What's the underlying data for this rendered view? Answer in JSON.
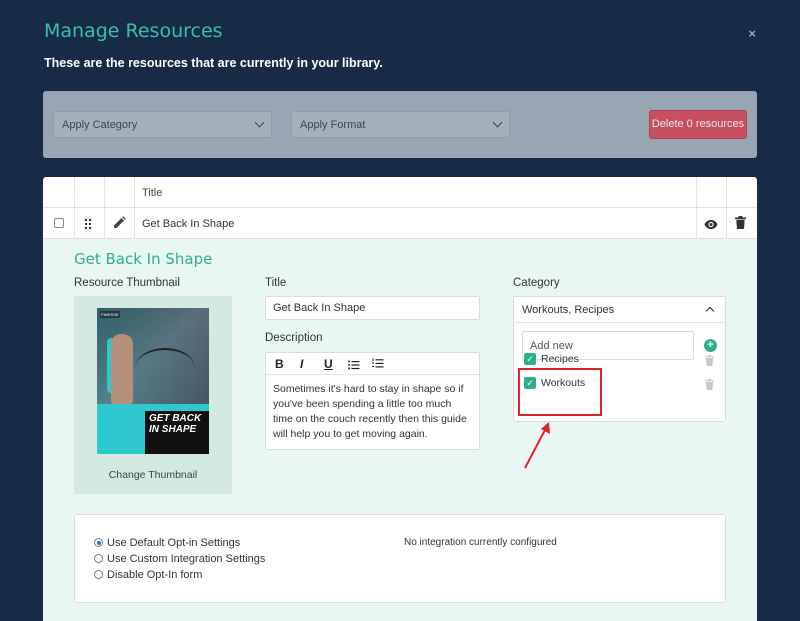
{
  "modal": {
    "title": "Manage Resources",
    "subtitle": "These are the resources that are currently in your library.",
    "close_glyph": "×"
  },
  "filters": {
    "category_select": "Apply Category",
    "format_select": "Apply Format",
    "delete_button": "Delete 0 resources"
  },
  "table": {
    "header_title": "Title",
    "rows": [
      {
        "title": "Get Back In Shape"
      }
    ]
  },
  "detail": {
    "heading": "Get Back In Shape",
    "thumbnail_label": "Resource Thumbnail",
    "thumbnail_cover_text": "GET BACK IN SHAPE",
    "thumbnail_logo": "FIMESSE",
    "change_thumbnail": "Change Thumbnail",
    "title_label": "Title",
    "title_value": "Get Back In Shape",
    "description_label": "Description",
    "toolbar": {
      "bold": "B",
      "italic": "I",
      "underline": "U"
    },
    "description_text": "Sometimes it's hard to stay in shape so if you've been spending a little too much time on the couch recently then this guide will help you to get moving again.",
    "category_label": "Category",
    "category_selected": "Workouts, Recipes",
    "add_new_placeholder": "Add new",
    "categories": [
      {
        "label": "Recipes",
        "checked": true
      },
      {
        "label": "Workouts",
        "checked": true
      }
    ]
  },
  "optin": {
    "options": [
      {
        "label": "Use Default Opt-in Settings",
        "selected": true
      },
      {
        "label": "Use Custom Integration Settings",
        "selected": false
      },
      {
        "label": "Disable Opt-In form",
        "selected": false
      }
    ],
    "integration_status": "No integration currently configured"
  },
  "colors": {
    "background": "#172b47",
    "accent": "#2fae8c",
    "delete": "#c6505f",
    "highlight": "#e0242b"
  }
}
